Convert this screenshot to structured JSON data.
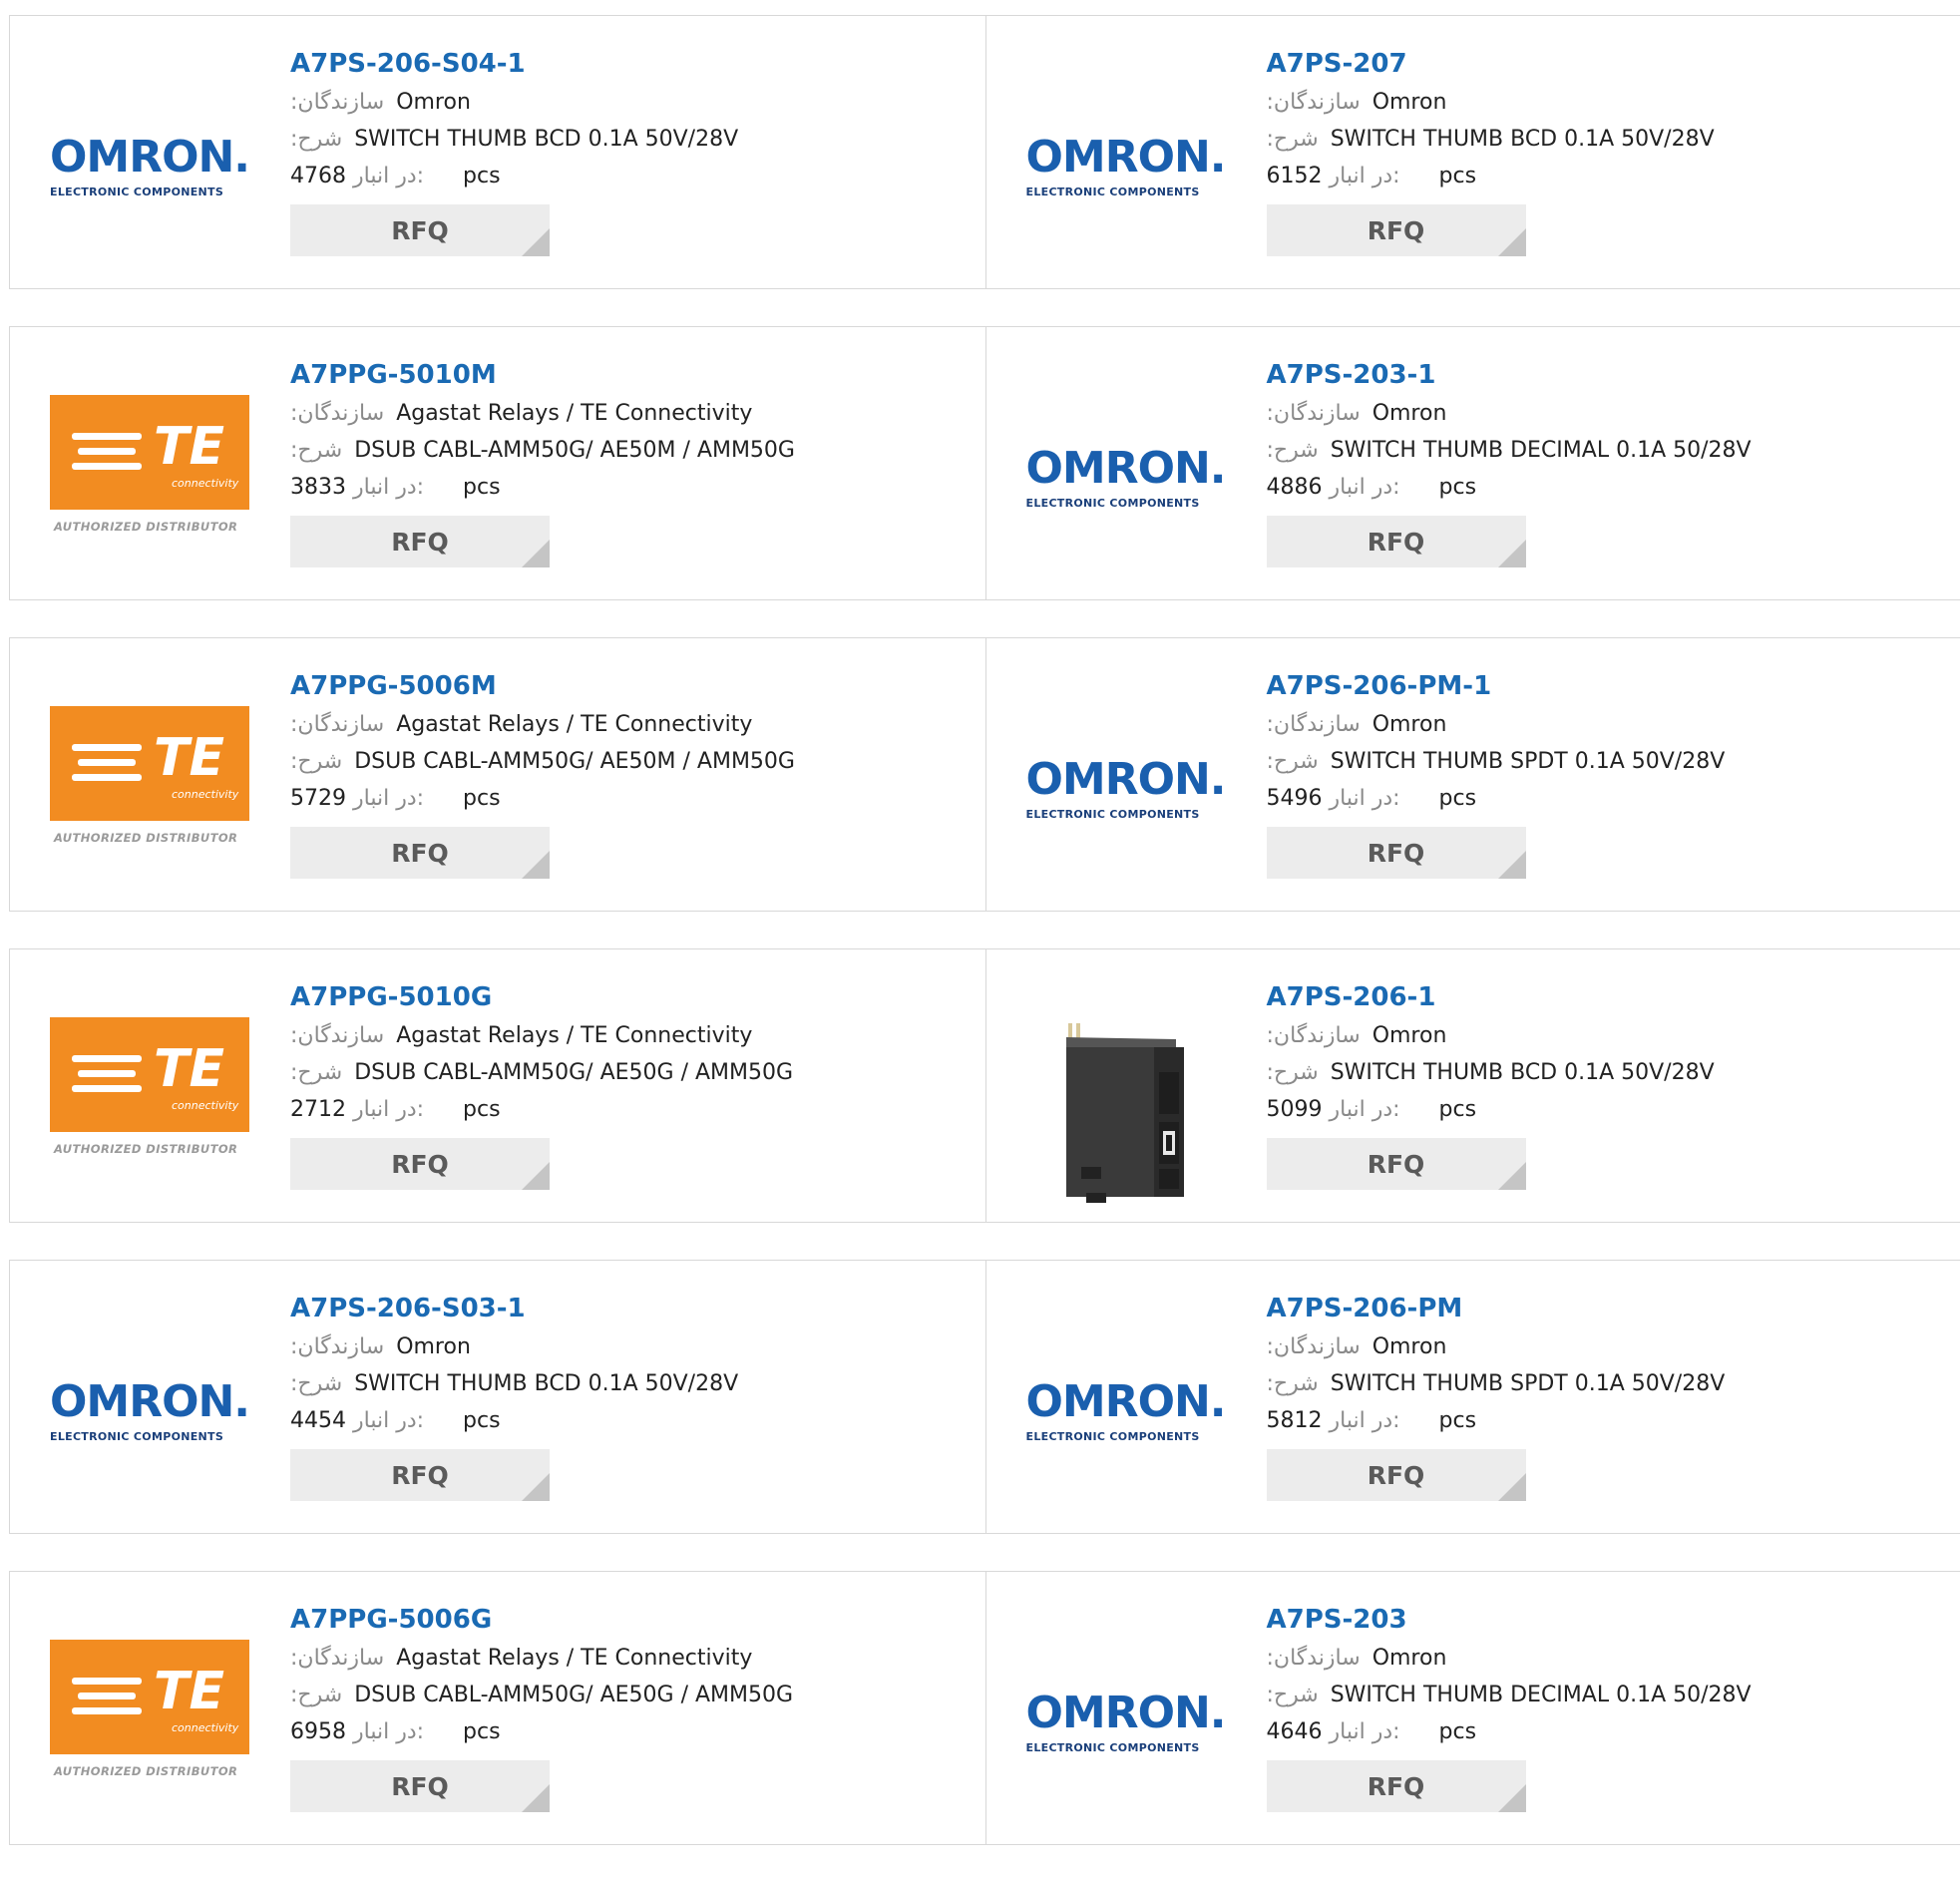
{
  "labels": {
    "manufacturer": ":سازندگان",
    "description": ":شرح",
    "stock": "در انبار:",
    "unit": "pcs",
    "rfq": "RFQ"
  },
  "logos": {
    "omron": {
      "word": "OMRON.",
      "sub": "ELECTRONIC COMPONENTS"
    },
    "te": {
      "word": "TE",
      "sub": "connectivity",
      "auth": "AUTHORIZED DISTRIBUTOR"
    }
  },
  "rows": [
    [
      {
        "logo": "omron",
        "part": "A7PS-206-S04-1",
        "manufacturer": "Omron",
        "description": "SWITCH THUMB BCD 0.1A 50V/28V",
        "stock": "4768"
      },
      {
        "logo": "omron",
        "part": "A7PS-207",
        "manufacturer": "Omron",
        "description": "SWITCH THUMB BCD 0.1A 50V/28V",
        "stock": "6152"
      }
    ],
    [
      {
        "logo": "te",
        "part": "A7PPG-5010M",
        "manufacturer": "Agastat Relays / TE Connectivity",
        "description": "DSUB CABL-AMM50G/ AE50M / AMM50G",
        "stock": "3833"
      },
      {
        "logo": "omron",
        "part": "A7PS-203-1",
        "manufacturer": "Omron",
        "description": "SWITCH THUMB DECIMAL 0.1A 50/28V",
        "stock": "4886"
      }
    ],
    [
      {
        "logo": "te",
        "part": "A7PPG-5006M",
        "manufacturer": "Agastat Relays / TE Connectivity",
        "description": "DSUB CABL-AMM50G/ AE50M / AMM50G",
        "stock": "5729"
      },
      {
        "logo": "omron",
        "part": "A7PS-206-PM-1",
        "manufacturer": "Omron",
        "description": "SWITCH THUMB SPDT 0.1A 50V/28V",
        "stock": "5496"
      }
    ],
    [
      {
        "logo": "te",
        "part": "A7PPG-5010G",
        "manufacturer": "Agastat Relays / TE Connectivity",
        "description": "DSUB CABL-AMM50G/ AE50G / AMM50G",
        "stock": "2712"
      },
      {
        "logo": "photo",
        "part": "A7PS-206-1",
        "manufacturer": "Omron",
        "description": "SWITCH THUMB BCD 0.1A 50V/28V",
        "stock": "5099"
      }
    ],
    [
      {
        "logo": "omron",
        "part": "A7PS-206-S03-1",
        "manufacturer": "Omron",
        "description": "SWITCH THUMB BCD 0.1A 50V/28V",
        "stock": "4454"
      },
      {
        "logo": "omron",
        "part": "A7PS-206-PM",
        "manufacturer": "Omron",
        "description": "SWITCH THUMB SPDT 0.1A 50V/28V",
        "stock": "5812"
      }
    ],
    [
      {
        "logo": "te",
        "part": "A7PPG-5006G",
        "manufacturer": "Agastat Relays / TE Connectivity",
        "description": "DSUB CABL-AMM50G/ AE50G / AMM50G",
        "stock": "6958"
      },
      {
        "logo": "omron",
        "part": "A7PS-203",
        "manufacturer": "Omron",
        "description": "SWITCH THUMB DECIMAL 0.1A 50/28V",
        "stock": "4646"
      }
    ]
  ]
}
